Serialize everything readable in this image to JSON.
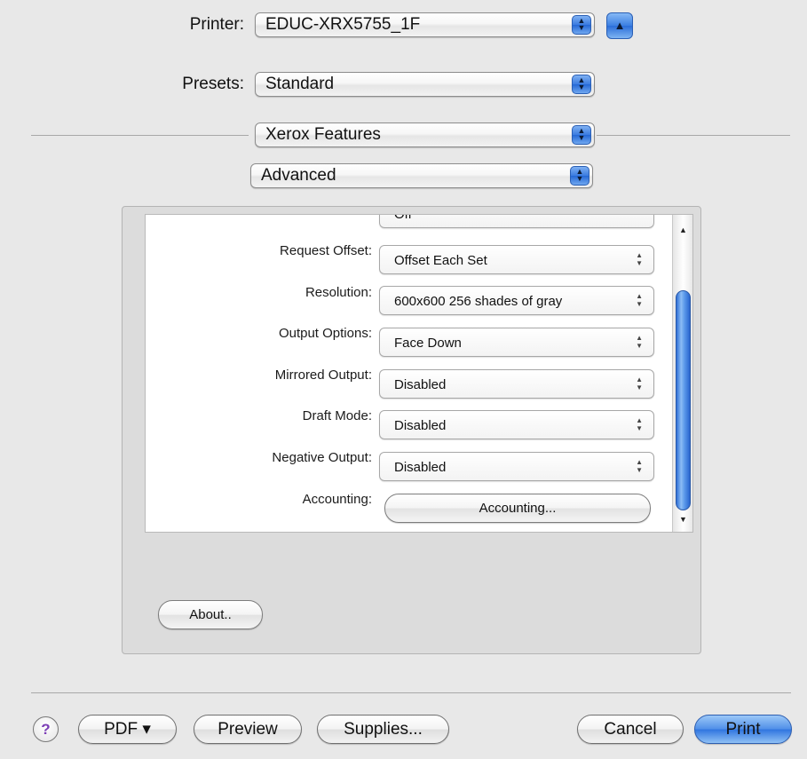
{
  "printer": {
    "label": "Printer:",
    "value": "EDUC-XRX5755_1F",
    "eject_symbol": "▲"
  },
  "presets": {
    "label": "Presets:",
    "value": "Standard"
  },
  "section_popup": {
    "value": "Xerox Features"
  },
  "subsection_popup": {
    "value": "Advanced"
  },
  "options": [
    {
      "label": "Request Offset:",
      "value": "Offset Each Set"
    },
    {
      "label": "Resolution:",
      "value": "600x600 256 shades of gray"
    },
    {
      "label": "Output Options:",
      "value": "Face Down"
    },
    {
      "label": "Mirrored Output:",
      "value": "Disabled"
    },
    {
      "label": "Draft Mode:",
      "value": "Disabled"
    },
    {
      "label": "Negative Output:",
      "value": "Disabled"
    }
  ],
  "partial_row_value": "Off",
  "accounting": {
    "label": "Accounting:",
    "button": "Accounting..."
  },
  "about_button": "About..",
  "bottom": {
    "help": "?",
    "pdf": "PDF ▾",
    "preview": "Preview",
    "supplies": "Supplies...",
    "cancel": "Cancel",
    "print": "Print"
  },
  "colors": {
    "accent": "#3a7be0",
    "window_bg": "#e8e8e8"
  }
}
